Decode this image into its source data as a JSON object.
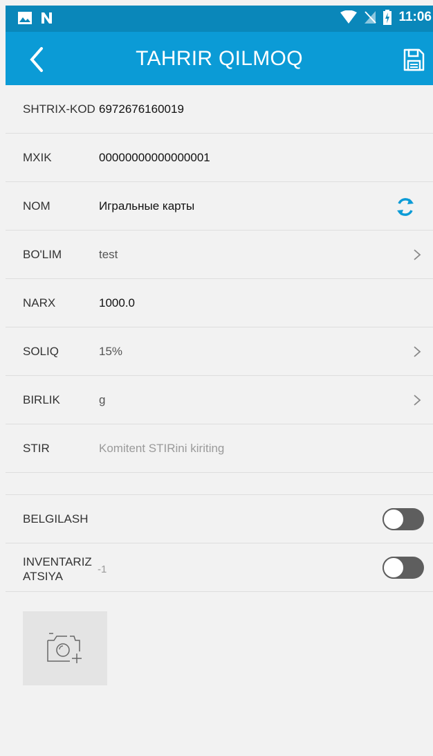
{
  "status_bar": {
    "time": "11:06",
    "left_icons": [
      "image-icon",
      "n-icon"
    ],
    "right_icons": [
      "wifi-icon",
      "no-sim-icon",
      "battery-charging-icon"
    ]
  },
  "app_bar": {
    "title": "TAHRIR QILMOQ",
    "back_icon": "chevron-left-icon",
    "save_icon": "save-icon",
    "color": "#0b9bd6"
  },
  "fields": {
    "barcode": {
      "label": "SHTRIX-KOD",
      "value": "6972676160019"
    },
    "mxik": {
      "label": "MXIK",
      "value": "00000000000000001"
    },
    "name": {
      "label": "NOM",
      "value": "Игральные карты"
    },
    "section": {
      "label": "BO'LIM",
      "value": "test"
    },
    "price": {
      "label": "NARX",
      "value": "1000.0"
    },
    "tax": {
      "label": "SOLIQ",
      "value": "15%"
    },
    "unit": {
      "label": "BIRLIK",
      "value": "g"
    },
    "stir": {
      "label": "STIR",
      "placeholder": "Komitent STIRini kiriting"
    }
  },
  "toggles": {
    "marking": {
      "label": "BELGILASH",
      "on": false
    },
    "inventory": {
      "label_line1": "INVENTARIZ",
      "label_line2": "ATSIYA",
      "value": "-1",
      "on": false
    }
  },
  "photo": {
    "icon": "add-photo-camera-icon"
  }
}
